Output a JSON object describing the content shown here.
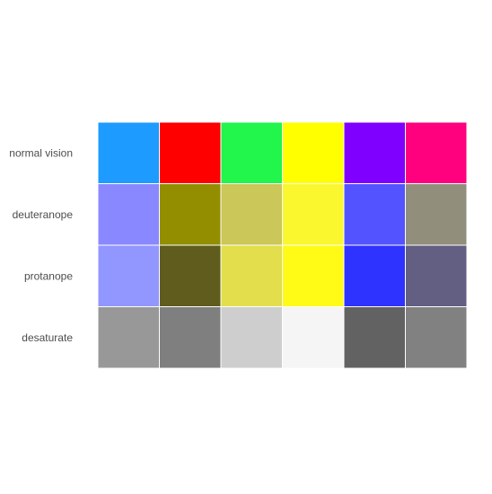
{
  "chart_data": {
    "type": "heatmap",
    "rows": [
      "normal vision",
      "deuteranope",
      "protanope",
      "desaturate"
    ],
    "colors": [
      [
        "#1E9BFF",
        "#FF0000",
        "#22F54C",
        "#FFFF00",
        "#8000FF",
        "#FF007E"
      ],
      [
        "#8A88FF",
        "#938E00",
        "#CBC758",
        "#FBF72F",
        "#5354FF",
        "#918F7B"
      ],
      [
        "#9296FF",
        "#5F5C1E",
        "#E2DE4C",
        "#FFFB17",
        "#2F33FF",
        "#625F82"
      ],
      [
        "#989898",
        "#7F7F7F",
        "#CECECE",
        "#F5F5F5",
        "#626262",
        "#818181"
      ]
    ]
  }
}
